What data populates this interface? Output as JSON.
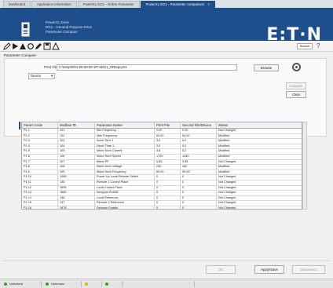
{
  "tabs": [
    {
      "label": "Dashboard"
    },
    {
      "label": "Application Information"
    },
    {
      "label": "PowerXL DG1 - Online Parameter"
    },
    {
      "label": "PowerXL DG1 - Parameter comparison",
      "close": "×"
    }
  ],
  "header": {
    "line1": "PowerXL Drive",
    "line2": "DG1 - General Purpose Drive",
    "line3": "Parameter Compare",
    "logo": "E:T·N"
  },
  "toolbar": {
    "search_label": "Search",
    "help_icon": "?"
  },
  "section_title": "Parameter Compare",
  "compare": {
    "print_file_label": "Print File",
    "print_file_value": "C:\\temp\\DG1-00-00-00-1P-mDG1_ORtopr.prnt",
    "browse_label": "Browse",
    "device_value": "Device",
    "compare_label": "Compare",
    "clear_label": "Clear"
  },
  "grid": {
    "columns": [
      "Param Code",
      "Modbus ID",
      "Parameter Name",
      "Print File",
      "Second File/Device",
      "Status"
    ],
    "rows": [
      [
        "P1.1",
        "101",
        "Min Frequency",
        "0.00",
        "0.00",
        "Not Changed"
      ],
      [
        "P1.2",
        "102",
        "Max Frequency",
        "60.00",
        "50.00",
        "Modified"
      ],
      [
        "P1.3",
        "103",
        "Accel Time 1",
        "3.0",
        "5.0",
        "Modified"
      ],
      [
        "P1.4",
        "104",
        "Decel Time 1",
        "3.0",
        "5.0",
        "Modified"
      ],
      [
        "P1.5",
        "105",
        "Motor Nom Current",
        "4.8",
        "5.2",
        "Modified"
      ],
      [
        "P1.6",
        "106",
        "Motor Nom Speed",
        "1720",
        "1440",
        "Modified"
      ],
      [
        "P1.7",
        "107",
        "Motor PF",
        "0.85",
        "0.85",
        "Not Changed"
      ],
      [
        "P1.8",
        "108",
        "Motor Nom Voltage",
        "230",
        "400",
        "Modified"
      ],
      [
        "P1.9",
        "109",
        "Motor Nom Frequency",
        "60.00",
        "50.00",
        "Modified"
      ],
      [
        "P1.10",
        "1088",
        "Power Up Local Remote Select",
        "0",
        "0",
        "Not Changed"
      ],
      [
        "P1.11",
        "135",
        "Remote 1 Control Place",
        "0",
        "0",
        "Not Changed"
      ],
      [
        "P1.12",
        "1695",
        "Local Control Place",
        "0",
        "0",
        "Not Changed"
      ],
      [
        "P1.13",
        "1685",
        "Kkeypad Enable",
        "0",
        "0",
        "Not Changed"
      ],
      [
        "P1.14",
        "136",
        "Local Reference",
        "0",
        "0",
        "Not Changed"
      ],
      [
        "P1.15",
        "137",
        "Remote 1 Reference",
        "0",
        "0",
        "Not Changed"
      ],
      [
        "P1.16",
        "1678",
        "Reverse Enable",
        "0",
        "0",
        "Not Changed"
      ],
      [
        "P1.17",
        "1675",
        "Run Delay Time",
        "0",
        "0",
        "Not Changed"
      ]
    ]
  },
  "buttons": {
    "ok": "OK",
    "apply": "Apply/Save",
    "cancel": "Disconnect"
  },
  "statusbar": {
    "item1": "Unlocked",
    "item2": "Unknown",
    "ready_color": "#3a9d23",
    "warn_color": "#e0b400"
  },
  "colors": {
    "brand_blue": "#1f4e8c"
  }
}
